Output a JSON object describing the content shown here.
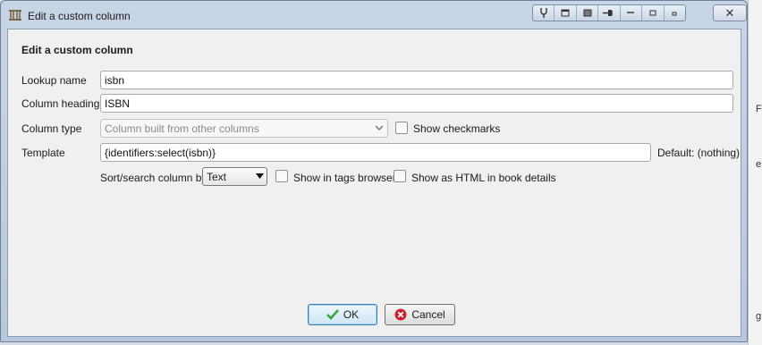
{
  "window": {
    "title": "Edit a custom column",
    "close_glyph": "✕"
  },
  "title_tools": [
    "pin-icon",
    "restore-icon",
    "shade-icon",
    "pushpin-icon",
    "minimize-icon",
    "maximize-icon",
    "small-icon"
  ],
  "dialog": {
    "heading": "Edit a custom column",
    "lookup_name": {
      "label": "Lookup name",
      "value": "isbn"
    },
    "column_heading": {
      "label": "Column heading",
      "value": "ISBN"
    },
    "column_type": {
      "label": "Column type",
      "value": "Column built from other columns"
    },
    "show_checkmarks": {
      "label": "Show checkmarks",
      "checked": false
    },
    "template": {
      "label": "Template",
      "value": "{identifiers:select(isbn)}",
      "default_note": "Default: (nothing)"
    },
    "sort_search": {
      "label": "Sort/search column by",
      "value": "Text"
    },
    "show_in_tags_browser": {
      "label": "Show in tags browser",
      "checked": false
    },
    "show_as_html": {
      "label": "Show as HTML in book details",
      "checked": false
    }
  },
  "buttons": {
    "ok": "OK",
    "cancel": "Cancel"
  },
  "colors": {
    "ok_check": "#3aa33a",
    "cancel_circle": "#c8242b"
  },
  "background_glyphs": [
    "F",
    "e",
    "g"
  ]
}
